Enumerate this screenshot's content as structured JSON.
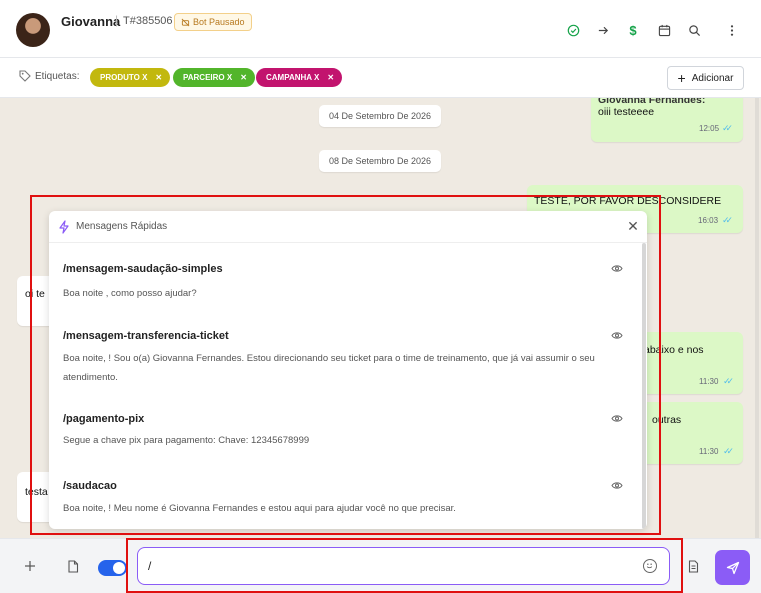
{
  "header": {
    "contact_name": "Giovanna",
    "ticket": "T#385506",
    "bot_status": "Bot Pausado"
  },
  "tags": {
    "label": "Etiquetas:",
    "items": [
      {
        "label": "PRODUTO X",
        "color": "#c2b80e"
      },
      {
        "label": "PARCEIRO X",
        "color": "#52b52b"
      },
      {
        "label": "CAMPANHA X",
        "color": "#c2146e"
      }
    ],
    "add_label": "Adicionar"
  },
  "chat": {
    "dates": [
      "04 De Setembro De 2026",
      "08 De Setembro De 2026"
    ],
    "outgoing": [
      {
        "sender": "Giovanna Fernandes:",
        "text": "oiii testeeee",
        "time": "12:05"
      },
      {
        "text": "TESTE, POR FAVOR DESCONSIDERE",
        "time": "16:03"
      },
      {
        "text": "abaixo e nos",
        "time": "11:30"
      },
      {
        "text": "outras",
        "time": "11:30"
      }
    ],
    "incoming": [
      {
        "text": "oi te"
      },
      {
        "text": "testa"
      }
    ]
  },
  "quick_messages": {
    "title": "Mensagens Rápidas",
    "items": [
      {
        "command": "/mensagem-saudação-simples",
        "text": "Boa noite , como posso ajudar?"
      },
      {
        "command": "/mensagem-transferencia-ticket",
        "text": "Boa noite, ! Sou o(a) Giovanna Fernandes. Estou direcionando seu ticket para o time de treinamento, que já vai assumir o seu atendimento."
      },
      {
        "command": "/pagamento-pix",
        "text": "Segue a chave pix para pagamento: Chave: 12345678999"
      },
      {
        "command": "/saudacao",
        "text": "Boa noite, ! Meu nome é Giovanna Fernandes e estou aqui para ajudar você no que precisar."
      }
    ]
  },
  "composer": {
    "value": "/",
    "accent": "#8b5cf6",
    "toggle_on": true
  },
  "colors": {
    "highlight": "#e01010",
    "outgoing_bubble": "#dcf8c6",
    "chat_bg": "#efeae2"
  }
}
